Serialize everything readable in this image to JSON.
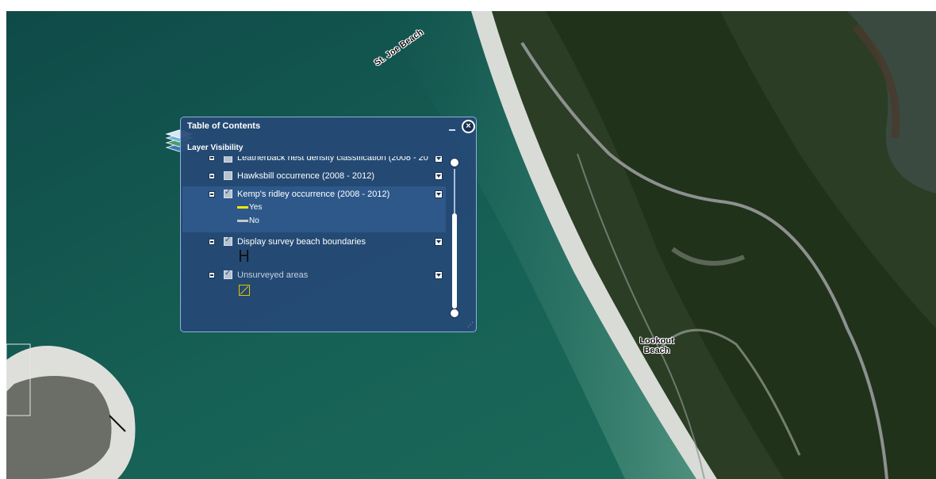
{
  "map": {
    "labels": {
      "st_joe_beach": "St. Joe Beach",
      "lookout_beach": "Lookout Beach"
    },
    "colors": {
      "water": "#14574f",
      "land": "#26371f",
      "sand": "#d9dcd6"
    }
  },
  "toc": {
    "title": "Table of Contents",
    "subtitle": "Layer Visibility",
    "close_icon": "×",
    "layers": [
      {
        "name": "Leatherback nest density classification (2008 - 20",
        "checked": false
      },
      {
        "name": "Hawksbill occurrence (2008 - 2012)",
        "checked": false
      },
      {
        "name": "Kemp's ridley occurrence (2008 - 2012)",
        "checked": true,
        "legend": [
          {
            "label": "Yes",
            "color": "#f2e600"
          },
          {
            "label": "No",
            "color": "#c8c8c8"
          }
        ]
      },
      {
        "name": "Display survey beach boundaries",
        "checked": true,
        "symbol": "H"
      },
      {
        "name": "Unsurveyed areas",
        "checked": true,
        "symbol_icon": "hatched-square-icon"
      }
    ]
  }
}
